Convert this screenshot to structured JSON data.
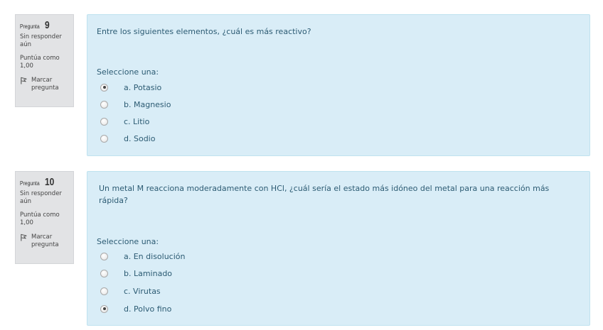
{
  "questions": [
    {
      "label": "Pregunta",
      "number": "9",
      "state": "Sin responder aún",
      "grade": "Puntúa como 1,00",
      "flag_label": "Marcar pregunta",
      "text": "Entre los siguientes elementos, ¿cuál es más reactivo?",
      "prompt": "Seleccione una:",
      "options": [
        {
          "label": "a. Potasio",
          "checked": true
        },
        {
          "label": "b. Magnesio",
          "checked": false
        },
        {
          "label": "c. Litio",
          "checked": false
        },
        {
          "label": "d. Sodio",
          "checked": false
        }
      ]
    },
    {
      "label": "Pregunta",
      "number": "10",
      "state": "Sin responder aún",
      "grade": "Puntúa como 1,00",
      "flag_label": "Marcar pregunta",
      "text": "Un metal M reacciona moderadamente con HCl, ¿cuál sería el estado más idóneo del metal para una reacción más rápida?",
      "prompt": "Seleccione una:",
      "options": [
        {
          "label": "a. En disolución",
          "checked": false
        },
        {
          "label": "b. Laminado",
          "checked": false
        },
        {
          "label": "c. Virutas",
          "checked": false
        },
        {
          "label": "d. Polvo fino",
          "checked": true
        }
      ]
    }
  ]
}
